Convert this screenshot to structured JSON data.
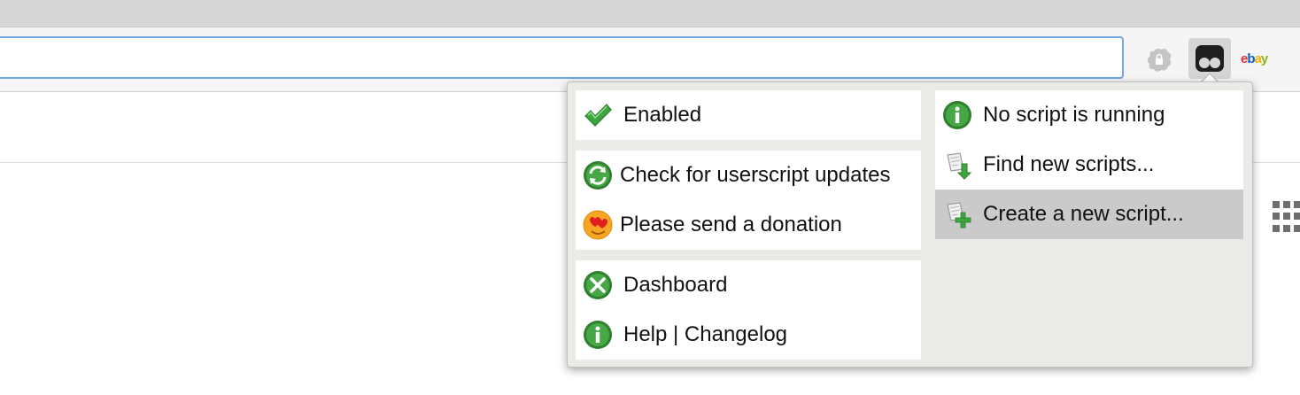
{
  "toolbar": {
    "omnibox_value": "",
    "extensions": [
      {
        "name": "lock-extension"
      },
      {
        "name": "tampermonkey-extension"
      },
      {
        "name": "ebay-extension",
        "text": [
          "e",
          "b",
          "a",
          "y"
        ]
      }
    ]
  },
  "menu": {
    "left": {
      "status": {
        "label": "Enabled",
        "icon": "check-icon"
      },
      "actions": [
        {
          "label": "Check for userscript updates",
          "icon": "refresh-icon"
        },
        {
          "label": "Please send a donation",
          "icon": "heart-eyes-icon"
        }
      ],
      "links": [
        {
          "label": "Dashboard",
          "icon": "tools-icon"
        },
        {
          "label": "Help | Changelog",
          "icon": "info-icon"
        }
      ]
    },
    "right": {
      "items": [
        {
          "label": "No script is running",
          "icon": "info-icon"
        },
        {
          "label": "Find new scripts...",
          "icon": "download-script-icon"
        },
        {
          "label": "Create a new script...",
          "icon": "add-script-icon",
          "highlighted": true
        }
      ]
    }
  },
  "colors": {
    "accent_green": "#2e7d2e",
    "highlight": "#cacaca",
    "omnibox_border": "#6fa6e6"
  }
}
